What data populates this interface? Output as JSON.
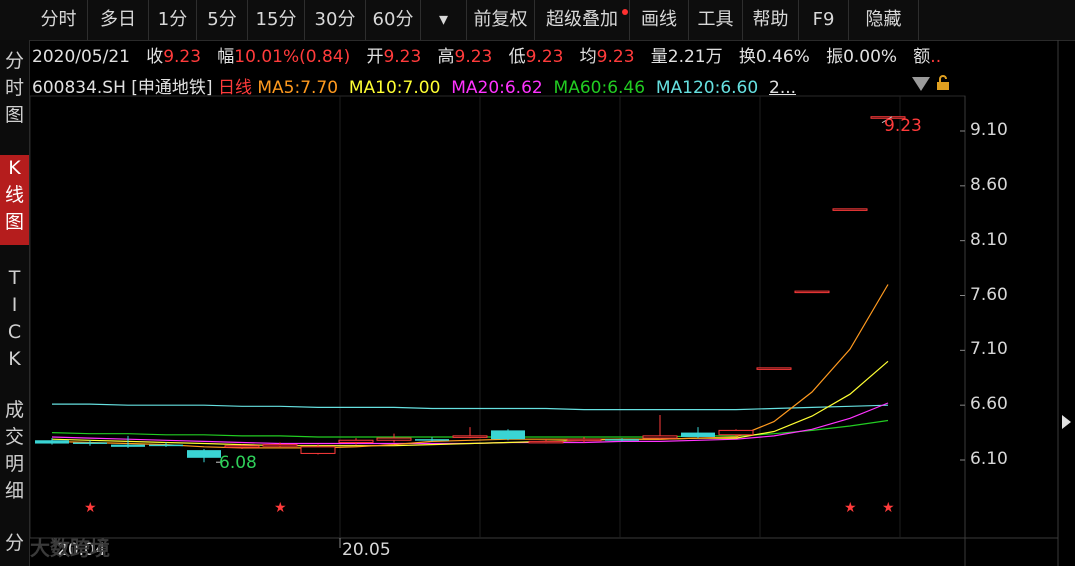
{
  "toolbar": {
    "items": [
      "分时",
      "多日",
      "1分",
      "5分",
      "15分",
      "30分",
      "60分",
      "▾",
      "前复权",
      "超级叠加",
      "画线",
      "工具",
      "帮助",
      "F9",
      "隐藏"
    ]
  },
  "leftnav": {
    "items": [
      "分\n时\n图",
      "K\n线\n图",
      "T\nI\nC\nK",
      "成\n交\n明\n细",
      "分"
    ]
  },
  "info": {
    "date": "2020/05/21",
    "close_label": "收",
    "close": "9.23",
    "range_label": "幅",
    "range": "10.01%(0.84)",
    "open_label": "开",
    "open": "9.23",
    "high_label": "高",
    "high": "9.23",
    "low_label": "低",
    "low": "9.23",
    "avg_label": "均",
    "avg": "9.23",
    "vol_label": "量",
    "vol": "2.21万",
    "turnover_label": "换",
    "turnover": "0.46%",
    "amp_label": "振",
    "amp": "0.00%",
    "amount_label": "额"
  },
  "legend": {
    "symbol": "600834.SH",
    "name": "[申通地铁]",
    "period": "日线",
    "ma5": "MA5:7.70",
    "ma10": "MA10:7.00",
    "ma20": "MA20:6.62",
    "ma60": "MA60:6.46",
    "ma120": "MA120:6.60",
    "more": "2..."
  },
  "colors": {
    "up": "#ff3b3b",
    "down": "#3ad4d4",
    "ma5": "#ff9a1f",
    "ma10": "#ffff33",
    "ma20": "#ff33ff",
    "ma60": "#22cc22",
    "ma120": "#66e0e0",
    "background": "#000000",
    "active_tab": "#b51d1d"
  },
  "chart_data": {
    "type": "candlestick",
    "y_ticks": [
      "9.10",
      "8.60",
      "8.10",
      "7.60",
      "7.10",
      "6.60",
      "6.10"
    ],
    "x_ticks": [
      "20.04",
      "20.05"
    ],
    "high_marker": "9.23",
    "low_marker": "6.08",
    "candles": [
      {
        "o": 6.28,
        "c": 6.25,
        "h": 6.3,
        "l": 6.24
      },
      {
        "o": 6.26,
        "c": 6.25,
        "h": 6.28,
        "l": 6.23
      },
      {
        "o": 6.24,
        "c": 6.22,
        "h": 6.32,
        "l": 6.21
      },
      {
        "o": 6.24,
        "c": 6.23,
        "h": 6.26,
        "l": 6.22
      },
      {
        "o": 6.19,
        "c": 6.12,
        "h": 6.2,
        "l": 6.08
      },
      {
        "o": 6.22,
        "c": 6.23,
        "h": 6.24,
        "l": 6.2
      },
      {
        "o": 6.24,
        "c": 6.24,
        "h": 6.26,
        "l": 6.22
      },
      {
        "o": 6.16,
        "c": 6.22,
        "h": 6.24,
        "l": 6.15
      },
      {
        "o": 6.26,
        "c": 6.28,
        "h": 6.3,
        "l": 6.24
      },
      {
        "o": 6.28,
        "c": 6.3,
        "h": 6.34,
        "l": 6.26
      },
      {
        "o": 6.29,
        "c": 6.28,
        "h": 6.31,
        "l": 6.27
      },
      {
        "o": 6.32,
        "c": 6.32,
        "h": 6.4,
        "l": 6.3
      },
      {
        "o": 6.37,
        "c": 6.29,
        "h": 6.38,
        "l": 6.28
      },
      {
        "o": 6.27,
        "c": 6.27,
        "h": 6.29,
        "l": 6.25
      },
      {
        "o": 6.28,
        "c": 6.29,
        "h": 6.31,
        "l": 6.26
      },
      {
        "o": 6.29,
        "c": 6.28,
        "h": 6.3,
        "l": 6.27
      },
      {
        "o": 6.3,
        "c": 6.32,
        "h": 6.51,
        "l": 6.29
      },
      {
        "o": 6.35,
        "c": 6.31,
        "h": 6.4,
        "l": 6.3
      },
      {
        "o": 6.33,
        "c": 6.37,
        "h": 6.38,
        "l": 6.32
      },
      {
        "o": 6.94,
        "c": 6.94,
        "h": 6.94,
        "l": 6.94
      },
      {
        "o": 7.64,
        "c": 7.64,
        "h": 7.64,
        "l": 7.64
      },
      {
        "o": 8.39,
        "c": 8.39,
        "h": 8.39,
        "l": 8.39
      },
      {
        "o": 9.23,
        "c": 9.23,
        "h": 9.23,
        "l": 9.23
      }
    ],
    "ma5": [
      6.27,
      6.26,
      6.25,
      6.24,
      6.22,
      6.21,
      6.21,
      6.21,
      6.22,
      6.24,
      6.27,
      6.28,
      6.29,
      6.29,
      6.29,
      6.29,
      6.29,
      6.3,
      6.31,
      6.45,
      6.72,
      7.11,
      7.7
    ],
    "ma10": [
      6.29,
      6.28,
      6.27,
      6.26,
      6.25,
      6.24,
      6.23,
      6.23,
      6.23,
      6.23,
      6.24,
      6.25,
      6.26,
      6.27,
      6.28,
      6.29,
      6.29,
      6.3,
      6.3,
      6.36,
      6.5,
      6.7,
      7.0
    ],
    "ma20": [
      6.31,
      6.3,
      6.29,
      6.28,
      6.27,
      6.26,
      6.25,
      6.25,
      6.25,
      6.25,
      6.25,
      6.25,
      6.26,
      6.26,
      6.26,
      6.27,
      6.27,
      6.28,
      6.29,
      6.32,
      6.38,
      6.48,
      6.62
    ],
    "ma60": [
      6.35,
      6.34,
      6.34,
      6.33,
      6.33,
      6.32,
      6.32,
      6.31,
      6.31,
      6.31,
      6.31,
      6.31,
      6.31,
      6.31,
      6.31,
      6.31,
      6.31,
      6.32,
      6.32,
      6.34,
      6.37,
      6.41,
      6.46
    ],
    "ma120": [
      6.61,
      6.61,
      6.6,
      6.6,
      6.6,
      6.59,
      6.59,
      6.58,
      6.58,
      6.58,
      6.57,
      6.57,
      6.57,
      6.57,
      6.56,
      6.56,
      6.56,
      6.56,
      6.56,
      6.57,
      6.58,
      6.59,
      6.6
    ],
    "star_candle_indexes": [
      1,
      6,
      21,
      22
    ]
  }
}
